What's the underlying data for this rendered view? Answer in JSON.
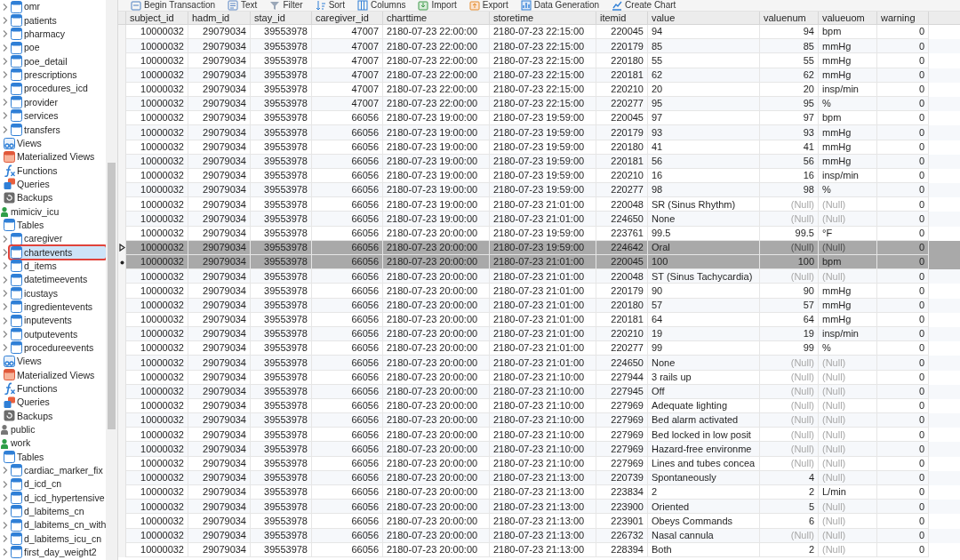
{
  "toolbar": [
    {
      "kind": "transaction",
      "label": "Begin Transaction"
    },
    {
      "kind": "text",
      "label": "Text"
    },
    {
      "kind": "filter",
      "label": "Filter"
    },
    {
      "kind": "sort",
      "label": "Sort"
    },
    {
      "kind": "columns",
      "label": "Columns"
    },
    {
      "kind": "import",
      "label": "Import"
    },
    {
      "kind": "export",
      "label": "Export"
    },
    {
      "kind": "generate",
      "label": "Data Generation"
    },
    {
      "kind": "chart",
      "label": "Create Chart"
    }
  ],
  "sidebar": {
    "outer_tables": [
      {
        "label": "omr",
        "selected": false
      },
      {
        "label": "patients",
        "selected": false
      },
      {
        "label": "pharmacy",
        "selected": false
      },
      {
        "label": "poe",
        "selected": false
      },
      {
        "label": "poe_detail",
        "selected": false
      },
      {
        "label": "prescriptions",
        "selected": false
      },
      {
        "label": "procedures_icd",
        "selected": false
      },
      {
        "label": "provider",
        "selected": false
      },
      {
        "label": "services",
        "selected": false
      },
      {
        "label": "transfers",
        "selected": false
      }
    ],
    "outer_objects": [
      {
        "kind": "views",
        "label": "Views"
      },
      {
        "kind": "matviews",
        "label": "Materialized Views"
      },
      {
        "kind": "functions",
        "label": "Functions"
      },
      {
        "kind": "queries",
        "label": "Queries"
      },
      {
        "kind": "backups",
        "label": "Backups"
      }
    ],
    "schemas": [
      {
        "label": "mimiciv_icu",
        "expanded": true,
        "children": [
          {
            "kind": "tables",
            "label": "Tables",
            "children": [
              {
                "label": "caregiver",
                "selected": false
              },
              {
                "label": "chartevents",
                "selected": true
              },
              {
                "label": "d_items",
                "selected": false
              },
              {
                "label": "datetimeevents",
                "selected": false
              },
              {
                "label": "icustays",
                "selected": false
              },
              {
                "label": "ingredientevents",
                "selected": false
              },
              {
                "label": "inputevents",
                "selected": false
              },
              {
                "label": "outputevents",
                "selected": false
              },
              {
                "label": "procedureevents",
                "selected": false
              }
            ]
          },
          {
            "kind": "views",
            "label": "Views"
          },
          {
            "kind": "matviews",
            "label": "Materialized Views"
          },
          {
            "kind": "functions",
            "label": "Functions"
          },
          {
            "kind": "queries",
            "label": "Queries"
          },
          {
            "kind": "backups",
            "label": "Backups"
          }
        ]
      },
      {
        "label": "public",
        "expanded": false
      },
      {
        "label": "work",
        "expanded": true,
        "children": [
          {
            "kind": "tables",
            "label": "Tables",
            "children": [
              {
                "label": "cardiac_marker_fix",
                "selected": false
              },
              {
                "label": "d_icd_cn",
                "selected": false
              },
              {
                "label": "d_icd_hypertensive",
                "selected": false
              },
              {
                "label": "d_labitems_cn",
                "selected": false
              },
              {
                "label": "d_labitems_cn_with",
                "selected": false
              },
              {
                "label": "d_labitems_icu_cn",
                "selected": false
              },
              {
                "label": "first_day_weight2",
                "selected": false
              }
            ]
          }
        ]
      }
    ]
  },
  "table": {
    "columns": [
      {
        "label": "subject_id"
      },
      {
        "label": "hadm_id"
      },
      {
        "label": "stay_id"
      },
      {
        "label": "caregiver_id"
      },
      {
        "label": "charttime"
      },
      {
        "label": "storetime"
      },
      {
        "label": "itemid"
      },
      {
        "label": "value"
      },
      {
        "label": "valuenum"
      },
      {
        "label": "valueuom"
      },
      {
        "label": "warning"
      }
    ],
    "rows": [
      {
        "selected": false,
        "current": false,
        "cells": [
          "10000032",
          "29079034",
          "39553978",
          "47007",
          "2180-07-23 22:00:00",
          "2180-07-23 22:15:00",
          "220045",
          "94",
          "94",
          "bpm",
          "0"
        ]
      },
      {
        "selected": false,
        "current": false,
        "cells": [
          "10000032",
          "29079034",
          "39553978",
          "47007",
          "2180-07-23 22:00:00",
          "2180-07-23 22:15:00",
          "220179",
          "85",
          "85",
          "mmHg",
          "0"
        ]
      },
      {
        "selected": false,
        "current": false,
        "cells": [
          "10000032",
          "29079034",
          "39553978",
          "47007",
          "2180-07-23 22:00:00",
          "2180-07-23 22:15:00",
          "220180",
          "55",
          "55",
          "mmHg",
          "0"
        ]
      },
      {
        "selected": false,
        "current": false,
        "cells": [
          "10000032",
          "29079034",
          "39553978",
          "47007",
          "2180-07-23 22:00:00",
          "2180-07-23 22:15:00",
          "220181",
          "62",
          "62",
          "mmHg",
          "0"
        ]
      },
      {
        "selected": false,
        "current": false,
        "cells": [
          "10000032",
          "29079034",
          "39553978",
          "47007",
          "2180-07-23 22:00:00",
          "2180-07-23 22:15:00",
          "220210",
          "20",
          "20",
          "insp/min",
          "0"
        ]
      },
      {
        "selected": false,
        "current": false,
        "cells": [
          "10000032",
          "29079034",
          "39553978",
          "47007",
          "2180-07-23 22:00:00",
          "2180-07-23 22:15:00",
          "220277",
          "95",
          "95",
          "%",
          "0"
        ]
      },
      {
        "selected": false,
        "current": false,
        "cells": [
          "10000032",
          "29079034",
          "39553978",
          "66056",
          "2180-07-23 19:00:00",
          "2180-07-23 19:59:00",
          "220045",
          "97",
          "97",
          "bpm",
          "0"
        ]
      },
      {
        "selected": false,
        "current": false,
        "cells": [
          "10000032",
          "29079034",
          "39553978",
          "66056",
          "2180-07-23 19:00:00",
          "2180-07-23 19:59:00",
          "220179",
          "93",
          "93",
          "mmHg",
          "0"
        ]
      },
      {
        "selected": false,
        "current": false,
        "cells": [
          "10000032",
          "29079034",
          "39553978",
          "66056",
          "2180-07-23 19:00:00",
          "2180-07-23 19:59:00",
          "220180",
          "41",
          "41",
          "mmHg",
          "0"
        ]
      },
      {
        "selected": false,
        "current": false,
        "cells": [
          "10000032",
          "29079034",
          "39553978",
          "66056",
          "2180-07-23 19:00:00",
          "2180-07-23 19:59:00",
          "220181",
          "56",
          "56",
          "mmHg",
          "0"
        ]
      },
      {
        "selected": false,
        "current": false,
        "cells": [
          "10000032",
          "29079034",
          "39553978",
          "66056",
          "2180-07-23 19:00:00",
          "2180-07-23 19:59:00",
          "220210",
          "16",
          "16",
          "insp/min",
          "0"
        ]
      },
      {
        "selected": false,
        "current": false,
        "cells": [
          "10000032",
          "29079034",
          "39553978",
          "66056",
          "2180-07-23 19:00:00",
          "2180-07-23 19:59:00",
          "220277",
          "98",
          "98",
          "%",
          "0"
        ]
      },
      {
        "selected": false,
        "current": false,
        "cells": [
          "10000032",
          "29079034",
          "39553978",
          "66056",
          "2180-07-23 19:00:00",
          "2180-07-23 21:01:00",
          "220048",
          "SR (Sinus Rhythm)",
          {
            "text": "(Null)",
            "null": true
          },
          {
            "text": "(Null)",
            "null": true
          },
          "0"
        ]
      },
      {
        "selected": false,
        "current": false,
        "cells": [
          "10000032",
          "29079034",
          "39553978",
          "66056",
          "2180-07-23 19:00:00",
          "2180-07-23 21:01:00",
          "224650",
          "None",
          {
            "text": "(Null)",
            "null": true
          },
          {
            "text": "(Null)",
            "null": true
          },
          "0"
        ]
      },
      {
        "selected": false,
        "current": false,
        "cells": [
          "10000032",
          "29079034",
          "39553978",
          "66056",
          "2180-07-23 20:00:00",
          "2180-07-23 19:59:00",
          "223761",
          "99.5",
          "99.5",
          "°F",
          "0"
        ]
      },
      {
        "selected": true,
        "current": true,
        "cells": [
          "10000032",
          "29079034",
          "39553978",
          "66056",
          "2180-07-23 20:00:00",
          "2180-07-23 19:59:00",
          "224642",
          "Oral",
          {
            "text": "(Null)",
            "null": true
          },
          {
            "text": "(Null)",
            "null": true
          },
          "0"
        ]
      },
      {
        "selected": true,
        "current": false,
        "cells": [
          "10000032",
          "29079034",
          "39553978",
          "66056",
          "2180-07-23 20:00:00",
          "2180-07-23 21:01:00",
          "220045",
          "100",
          "100",
          "bpm",
          "0"
        ]
      },
      {
        "selected": false,
        "current": false,
        "cells": [
          "10000032",
          "29079034",
          "39553978",
          "66056",
          "2180-07-23 20:00:00",
          "2180-07-23 21:01:00",
          "220048",
          "ST (Sinus Tachycardia)",
          {
            "text": "(Null)",
            "null": true
          },
          {
            "text": "(Null)",
            "null": true
          },
          "0"
        ]
      },
      {
        "selected": false,
        "current": false,
        "cells": [
          "10000032",
          "29079034",
          "39553978",
          "66056",
          "2180-07-23 20:00:00",
          "2180-07-23 21:01:00",
          "220179",
          "90",
          "90",
          "mmHg",
          "0"
        ]
      },
      {
        "selected": false,
        "current": false,
        "cells": [
          "10000032",
          "29079034",
          "39553978",
          "66056",
          "2180-07-23 20:00:00",
          "2180-07-23 21:01:00",
          "220180",
          "57",
          "57",
          "mmHg",
          "0"
        ]
      },
      {
        "selected": false,
        "current": false,
        "cells": [
          "10000032",
          "29079034",
          "39553978",
          "66056",
          "2180-07-23 20:00:00",
          "2180-07-23 21:01:00",
          "220181",
          "64",
          "64",
          "mmHg",
          "0"
        ]
      },
      {
        "selected": false,
        "current": false,
        "cells": [
          "10000032",
          "29079034",
          "39553978",
          "66056",
          "2180-07-23 20:00:00",
          "2180-07-23 21:01:00",
          "220210",
          "19",
          "19",
          "insp/min",
          "0"
        ]
      },
      {
        "selected": false,
        "current": false,
        "cells": [
          "10000032",
          "29079034",
          "39553978",
          "66056",
          "2180-07-23 20:00:00",
          "2180-07-23 21:01:00",
          "220277",
          "99",
          "99",
          "%",
          "0"
        ]
      },
      {
        "selected": false,
        "current": false,
        "cells": [
          "10000032",
          "29079034",
          "39553978",
          "66056",
          "2180-07-23 20:00:00",
          "2180-07-23 21:01:00",
          "224650",
          "None",
          {
            "text": "(Null)",
            "null": true
          },
          {
            "text": "(Null)",
            "null": true
          },
          "0"
        ]
      },
      {
        "selected": false,
        "current": false,
        "cells": [
          "10000032",
          "29079034",
          "39553978",
          "66056",
          "2180-07-23 20:00:00",
          "2180-07-23 21:10:00",
          "227944",
          "3 rails up",
          {
            "text": "(Null)",
            "null": true
          },
          {
            "text": "(Null)",
            "null": true
          },
          "0"
        ]
      },
      {
        "selected": false,
        "current": false,
        "cells": [
          "10000032",
          "29079034",
          "39553978",
          "66056",
          "2180-07-23 20:00:00",
          "2180-07-23 21:10:00",
          "227945",
          "Off",
          {
            "text": "(Null)",
            "null": true
          },
          {
            "text": "(Null)",
            "null": true
          },
          "0"
        ]
      },
      {
        "selected": false,
        "current": false,
        "cells": [
          "10000032",
          "29079034",
          "39553978",
          "66056",
          "2180-07-23 20:00:00",
          "2180-07-23 21:10:00",
          "227969",
          "Adequate lighting",
          {
            "text": "(Null)",
            "null": true
          },
          {
            "text": "(Null)",
            "null": true
          },
          "0"
        ]
      },
      {
        "selected": false,
        "current": false,
        "cells": [
          "10000032",
          "29079034",
          "39553978",
          "66056",
          "2180-07-23 20:00:00",
          "2180-07-23 21:10:00",
          "227969",
          "Bed alarm activated",
          {
            "text": "(Null)",
            "null": true
          },
          {
            "text": "(Null)",
            "null": true
          },
          "0"
        ]
      },
      {
        "selected": false,
        "current": false,
        "cells": [
          "10000032",
          "29079034",
          "39553978",
          "66056",
          "2180-07-23 20:00:00",
          "2180-07-23 21:10:00",
          "227969",
          "Bed locked in low posit",
          {
            "text": "(Null)",
            "null": true
          },
          {
            "text": "(Null)",
            "null": true
          },
          "0"
        ]
      },
      {
        "selected": false,
        "current": false,
        "cells": [
          "10000032",
          "29079034",
          "39553978",
          "66056",
          "2180-07-23 20:00:00",
          "2180-07-23 21:10:00",
          "227969",
          "Hazard-free environme",
          {
            "text": "(Null)",
            "null": true
          },
          {
            "text": "(Null)",
            "null": true
          },
          "0"
        ]
      },
      {
        "selected": false,
        "current": false,
        "cells": [
          "10000032",
          "29079034",
          "39553978",
          "66056",
          "2180-07-23 20:00:00",
          "2180-07-23 21:10:00",
          "227969",
          "Lines and tubes concea",
          {
            "text": "(Null)",
            "null": true
          },
          {
            "text": "(Null)",
            "null": true
          },
          "0"
        ]
      },
      {
        "selected": false,
        "current": false,
        "cells": [
          "10000032",
          "29079034",
          "39553978",
          "66056",
          "2180-07-23 20:00:00",
          "2180-07-23 21:13:00",
          "220739",
          "Spontaneously",
          "4",
          {
            "text": "(Null)",
            "null": true
          },
          "0"
        ]
      },
      {
        "selected": false,
        "current": false,
        "cells": [
          "10000032",
          "29079034",
          "39553978",
          "66056",
          "2180-07-23 20:00:00",
          "2180-07-23 21:13:00",
          "223834",
          "2",
          "2",
          "L/min",
          "0"
        ]
      },
      {
        "selected": false,
        "current": false,
        "cells": [
          "10000032",
          "29079034",
          "39553978",
          "66056",
          "2180-07-23 20:00:00",
          "2180-07-23 21:13:00",
          "223900",
          "Oriented",
          "5",
          {
            "text": "(Null)",
            "null": true
          },
          "0"
        ]
      },
      {
        "selected": false,
        "current": false,
        "cells": [
          "10000032",
          "29079034",
          "39553978",
          "66056",
          "2180-07-23 20:00:00",
          "2180-07-23 21:13:00",
          "223901",
          "Obeys Commands",
          "6",
          {
            "text": "(Null)",
            "null": true
          },
          "0"
        ]
      },
      {
        "selected": false,
        "current": false,
        "cells": [
          "10000032",
          "29079034",
          "39553978",
          "66056",
          "2180-07-23 20:00:00",
          "2180-07-23 21:13:00",
          "226732",
          "Nasal cannula",
          {
            "text": "(Null)",
            "null": true
          },
          {
            "text": "(Null)",
            "null": true
          },
          "0"
        ]
      },
      {
        "selected": false,
        "current": false,
        "cells": [
          "10000032",
          "29079034",
          "39553978",
          "66056",
          "2180-07-23 20:00:00",
          "2180-07-23 21:13:00",
          "228394",
          "Both",
          "2",
          {
            "text": "(Null)",
            "null": true
          },
          "0"
        ]
      }
    ]
  }
}
